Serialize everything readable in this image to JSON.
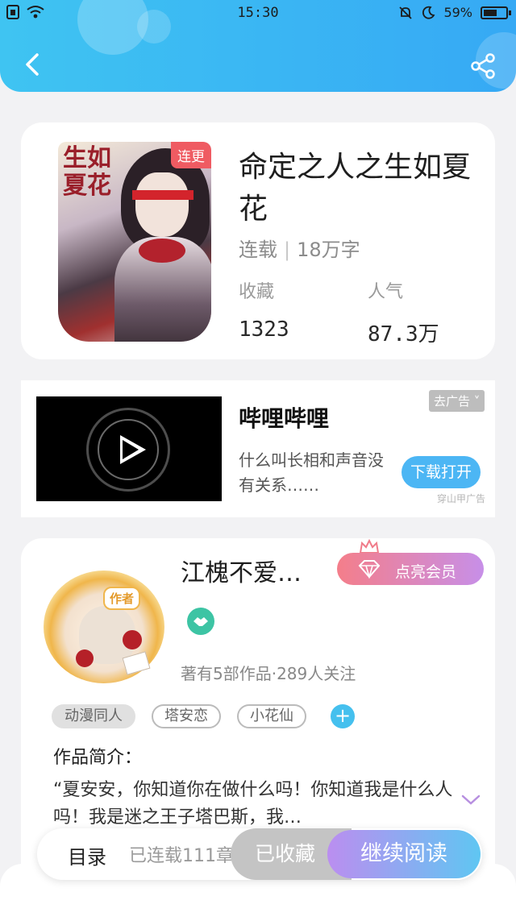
{
  "status_bar": {
    "time": "15:30",
    "battery": "59%"
  },
  "book": {
    "serial_badge": "连更",
    "cover_title": "生如夏花",
    "title": "命定之人之生如夏花",
    "status": "连载",
    "word_count": "18万字",
    "favorites_label": "收藏",
    "favorites_value": "1323",
    "popularity_label": "人气",
    "popularity_value": "87.3万"
  },
  "ad": {
    "title": "哔哩哔哩",
    "description": "什么叫长相和声音没有关系……",
    "remove_label": "去广告",
    "download_label": "下载打开",
    "source_label": "穿山甲广告",
    "progress": 0.0
  },
  "author": {
    "avatar_tag": "作者",
    "name": "江槐不爱…",
    "vip_label": "点亮会员",
    "stats": "著有5部作品·289人关注",
    "tags": [
      "动漫同人",
      "塔安恋",
      "小花仙"
    ],
    "intro_label": "作品简介：",
    "intro_text": "“夏安安，你知道你在做什么吗！你知道我是什么人吗！我是迷之王子塔巴斯，我…"
  },
  "bottom_bar": {
    "toc_label": "目录",
    "chapter_count": "已连载111章",
    "collected_label": "已收藏",
    "continue_label": "继续阅读"
  },
  "colors": {
    "header_start": "#3fc4f2",
    "header_end": "#36a9f4",
    "badge_red": "#ef5b62",
    "vip_start": "#f47e8a",
    "vip_end": "#c78fe8",
    "continue_start": "#bb8ef0",
    "continue_end": "#5fc6f2"
  }
}
